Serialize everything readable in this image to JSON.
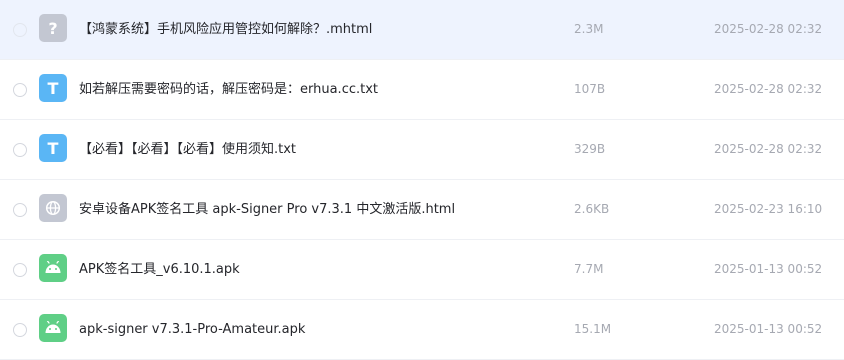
{
  "files": [
    {
      "name": "【鸿蒙系统】手机风险应用管控如何解除？.mhtml",
      "size": "2.3M",
      "date": "2025-02-28 02:32",
      "icon": "unknown-file-icon",
      "icon_glyph": "?",
      "icon_color": "#c3c7d2"
    },
    {
      "name": "如若解压需要密码的话，解压密码是：erhua.cc.txt",
      "size": "107B",
      "date": "2025-02-28 02:32",
      "icon": "text-file-icon",
      "icon_glyph": "T",
      "icon_color": "#5ab6f5"
    },
    {
      "name": "【必看】【必看】【必看】使用须知.txt",
      "size": "329B",
      "date": "2025-02-28 02:32",
      "icon": "text-file-icon",
      "icon_glyph": "T",
      "icon_color": "#5ab6f5"
    },
    {
      "name": "安卓设备APK签名工具 apk-Signer Pro v7.3.1 中文激活版.html",
      "size": "2.6KB",
      "date": "2025-02-23 16:10",
      "icon": "web-globe-icon",
      "icon_glyph": "",
      "icon_color": "#c3c7d2"
    },
    {
      "name": "APK签名工具_v6.10.1.apk",
      "size": "7.7M",
      "date": "2025-01-13 00:52",
      "icon": "android-apk-icon",
      "icon_glyph": "",
      "icon_color": "#5fcf86"
    },
    {
      "name": "apk-signer v7.3.1-Pro-Amateur.apk",
      "size": "15.1M",
      "date": "2025-01-13 00:52",
      "icon": "android-apk-icon",
      "icon_glyph": "",
      "icon_color": "#5fcf86"
    }
  ]
}
